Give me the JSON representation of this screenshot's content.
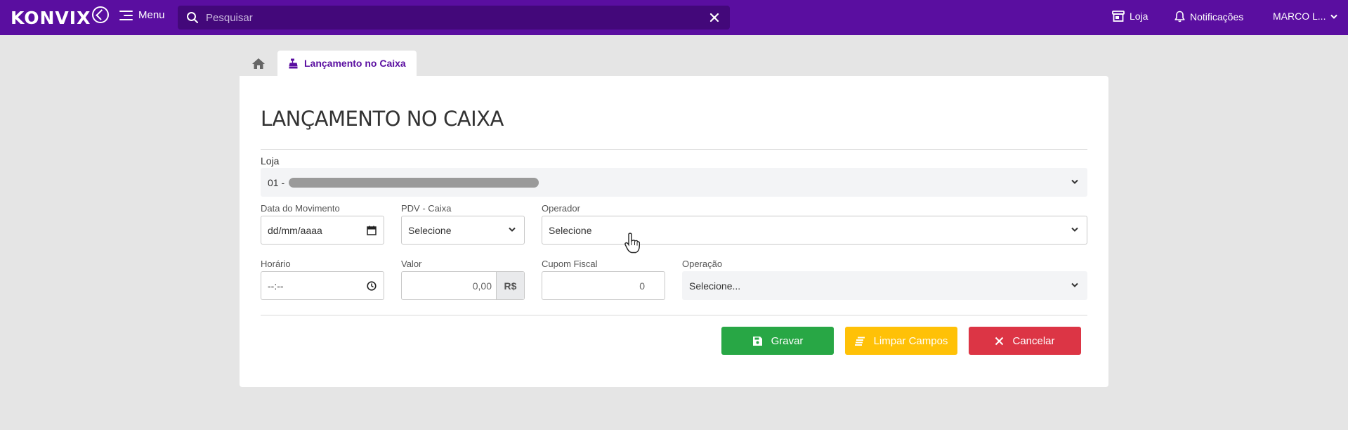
{
  "brand": {
    "logo_text": "KONVIX"
  },
  "topbar": {
    "menu_label": "Menu",
    "search_placeholder": "Pesquisar",
    "store_label": "Loja",
    "notifications_label": "Notificações",
    "user_label": "MARCO L...",
    "colors": {
      "bar": "#5a0ea0",
      "search_bg": "#43087a"
    }
  },
  "tabs": {
    "active_label": "Lançamento no Caixa"
  },
  "form": {
    "title": "LANÇAMENTO NO CAIXA",
    "loja": {
      "label": "Loja",
      "value_prefix": "01 -"
    },
    "data_movimento": {
      "label": "Data do Movimento",
      "value": "dd/mm/aaaa"
    },
    "pdv_caixa": {
      "label": "PDV - Caixa",
      "value": "Selecione"
    },
    "operador": {
      "label": "Operador",
      "value": "Selecione"
    },
    "horario": {
      "label": "Horário",
      "value": "--:--"
    },
    "valor": {
      "label": "Valor",
      "value": "0,00",
      "addon": "R$"
    },
    "cupom_fiscal": {
      "label": "Cupom Fiscal",
      "value": "0"
    },
    "operacao": {
      "label": "Operação",
      "value": "Selecione..."
    }
  },
  "buttons": {
    "save": "Gravar",
    "clear": "Limpar Campos",
    "cancel": "Cancelar",
    "colors": {
      "save": "#28a745",
      "clear": "#ffc107",
      "cancel": "#dc3545"
    }
  }
}
